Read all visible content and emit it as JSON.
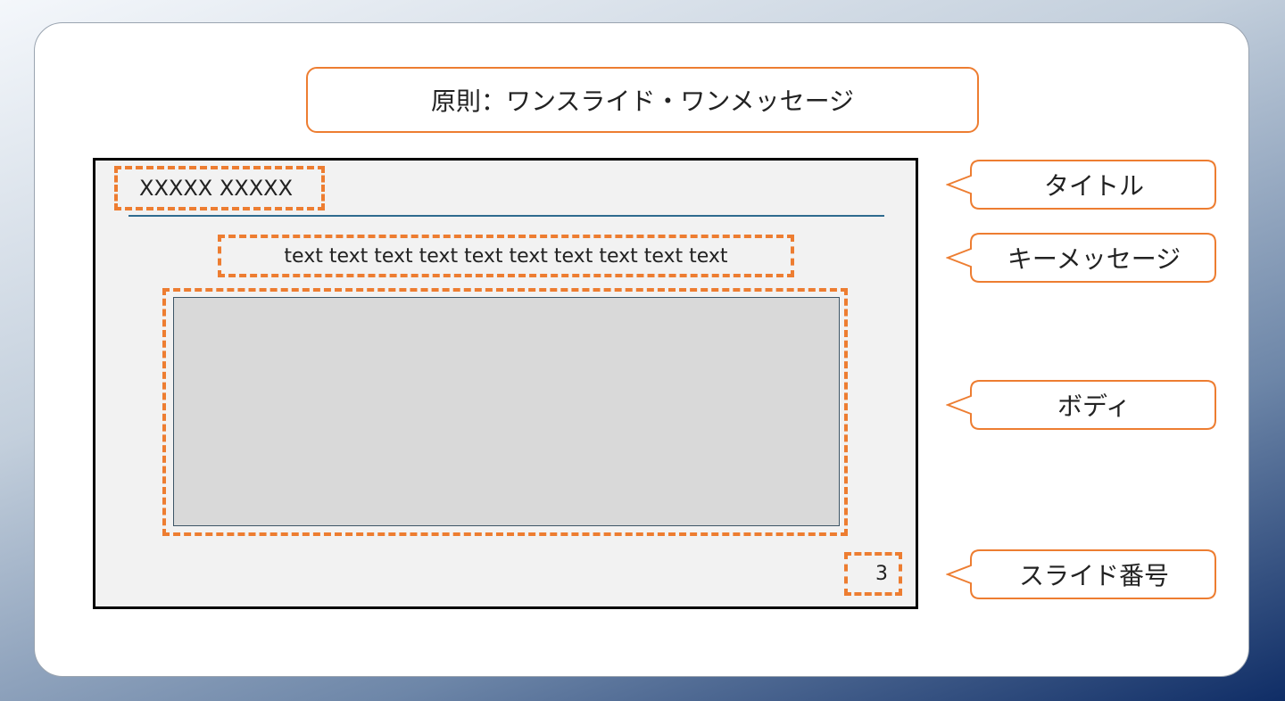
{
  "heading": "原則：ワンスライド・ワンメッセージ",
  "slide": {
    "title_placeholder": "XXXXX XXXXX",
    "key_message": "text text text text text text text text text text",
    "slide_number": "3"
  },
  "callouts": {
    "title": "タイトル",
    "key_message": "キーメッセージ",
    "body": "ボディ",
    "slide_number": "スライド番号"
  },
  "colors": {
    "accent": "#ed7d31",
    "slide_background": "#f2f2f2",
    "body_panel": "#d9d9d9",
    "title_rule": "#2f6b8f",
    "background_gradient_start": "#f4f7fb",
    "background_gradient_end": "#0f2d66"
  }
}
